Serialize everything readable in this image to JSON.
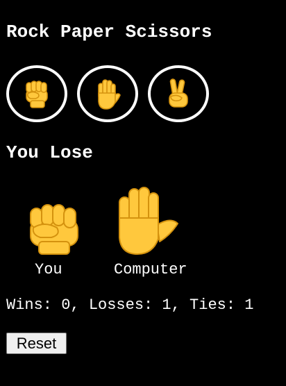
{
  "game": {
    "title": "Rock Paper Scissors",
    "result": "You Lose",
    "reset_label": "Reset"
  },
  "choices": [
    {
      "name": "rock",
      "icon": "raised-fist-icon"
    },
    {
      "name": "paper",
      "icon": "raised-hand-icon"
    },
    {
      "name": "scissors",
      "icon": "victory-hand-icon"
    }
  ],
  "round": {
    "player_label": "You",
    "player_choice_icon": "raised-fist-icon",
    "computer_label": "Computer",
    "computer_choice_icon": "raised-hand-icon"
  },
  "score": {
    "text": "Wins: 0, Losses: 1, Ties: 1",
    "wins": 0,
    "losses": 1,
    "ties": 1
  },
  "colors": {
    "background": "#000000",
    "text": "#ffffff",
    "emoji_skin": "#ffc83d",
    "emoji_outline": "#d4920e"
  }
}
